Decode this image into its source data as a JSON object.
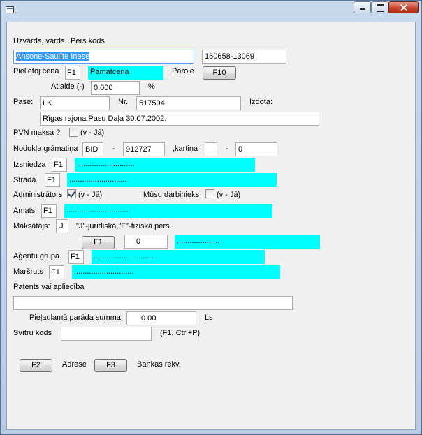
{
  "window": {
    "app_icon": "app-window-icon"
  },
  "labels": {
    "name": "Uzvārds, vārds",
    "pers_code": "Pers.kods",
    "price_used": "Pielietoj.cena",
    "password": "Parole",
    "discount": "Atlaide (-)",
    "percent": "%",
    "passport": "Pase:",
    "number": "Nr.",
    "issued": "Izdota:",
    "vat_payer": "PVN maksa ?",
    "vat_hint": "(v - Jā)",
    "tax_card": "Nodokļa grāmatiņa",
    "dot1": "-",
    "card": ",kartiņa",
    "dot2": "-",
    "issuer": "Izsniedza",
    "works": "Strādā",
    "administrators": "Administrātors",
    "admin_hint": "(v - Jā)",
    "our_employee": "Mūsu darbinieks",
    "employee_hint": "(v - Jā)",
    "position": "Amats",
    "payer": "Maksātājs:",
    "payer_hint": "\"J\"-juridiskā,\"F\"-fiziskā pers.",
    "agent_group": "Aģentu grupa",
    "route": "Maršruts",
    "patent": "Patents vai apliecība",
    "allowed_debt": "Pieļaulamā parāda summa:",
    "currency": "Ls",
    "barcode": "Svītru kods",
    "barcode_hint": "(F1, Ctrl+P)",
    "address": "Adrese",
    "bank": "Bankas rekv."
  },
  "fields": {
    "name": "Ansone-Saulīte Inese",
    "pers_code": "160658-13069",
    "price_key": "F1",
    "price_value": "Pamatcena",
    "discount": "0.000",
    "passport_series": "LK",
    "passport_number": "517594",
    "issued_by": "Rīgas rajona Pasu Daļa 30.07.2002.",
    "tax_series": "BID",
    "tax_number": "912727",
    "card_a": "",
    "card_b": "0",
    "issuer_key": "F1",
    "issuer_value": "...........................",
    "works_key": "F1",
    "works_value": "...........................",
    "position_key": "F1",
    "position_value": "..............................",
    "payer": "J",
    "payer_code": "0",
    "payer_value": "....................",
    "agent_key": "F1",
    "agent_value": "............................",
    "route_key": "F1",
    "route_value": "............................",
    "patent": "",
    "allowed_debt": "0.00",
    "barcode": ""
  },
  "checks": {
    "vat_payer": false,
    "administrators": true,
    "our_employee": false
  },
  "buttons": {
    "password": "F10",
    "payer_lookup": "F1",
    "address": "F2",
    "bank": "F3"
  }
}
